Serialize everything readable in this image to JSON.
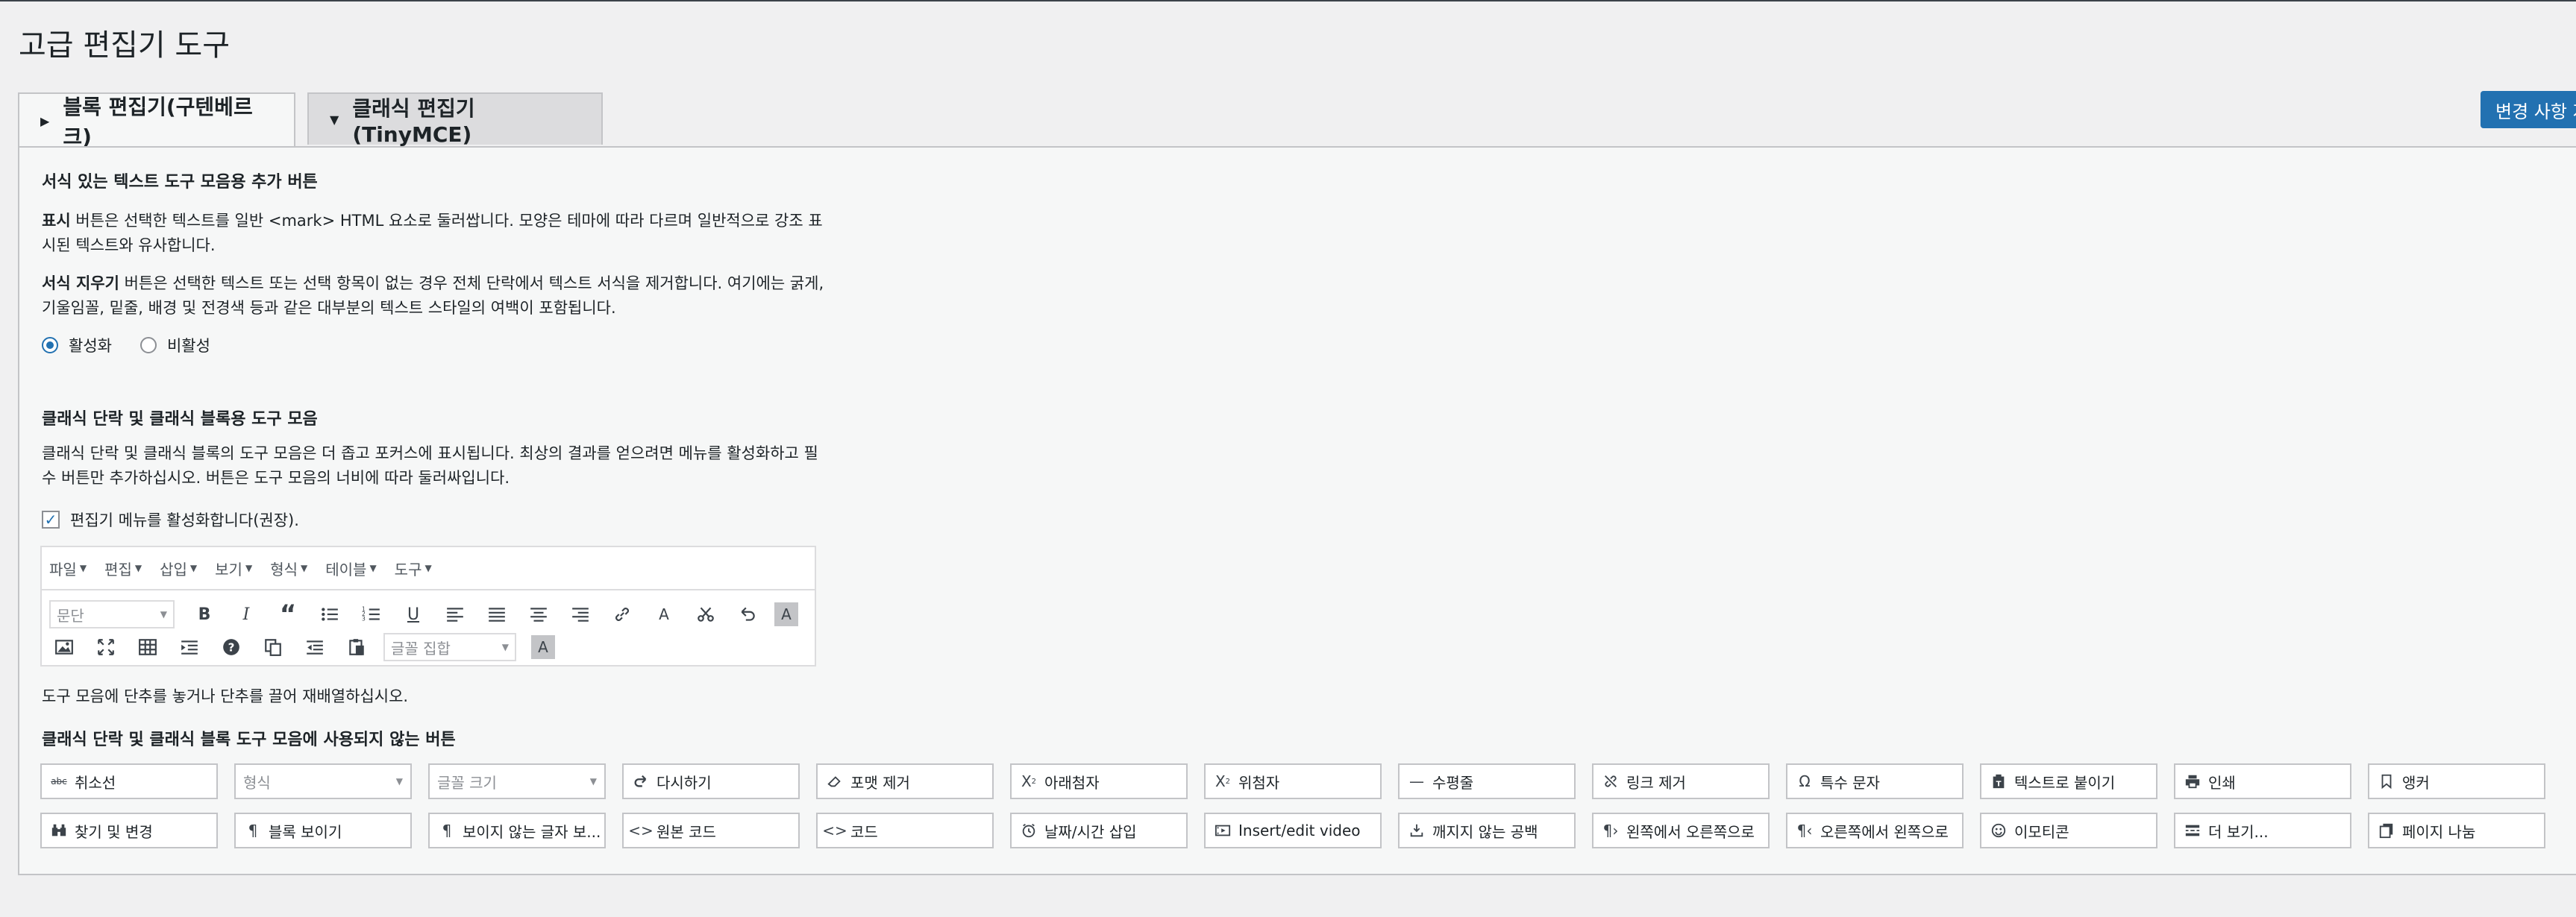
{
  "page_title": "고급 편집기 도구",
  "tabs": [
    {
      "label": "블록 편집기(구텐베르크)",
      "state": "expanded"
    },
    {
      "label": "클래식 편집기(TinyMCE)",
      "state": "collapsed"
    }
  ],
  "save_button": "변경 사항 저장",
  "section1": {
    "heading": "서식 있는 텍스트 도구 모음용 추가 버튼",
    "p1_strong": "표시",
    "p1_rest": " 버튼은 선택한 텍스트를 일반 <mark> HTML 요소로 둘러쌉니다. 모양은 테마에 따라 다르며 일반적으로 강조 표시된 텍스트와 유사합니다.",
    "p2_strong": "서식 지우기",
    "p2_rest": " 버튼은 선택한 텍스트 또는 선택 항목이 없는 경우 전체 단락에서 텍스트 서식을 제거합니다. 여기에는 굵게, 기울임꼴, 밑줄, 배경 및 전경색 등과 같은 대부분의 텍스트 스타일의 여백이 포함됩니다.",
    "radio_on": "활성화",
    "radio_off": "비활성",
    "selected": "활성화"
  },
  "section2": {
    "heading": "클래식 단락 및 클래식 블록용 도구 모음",
    "p1": "클래식 단락 및 클래식 블록의 도구 모음은 더 좁고 포커스에 표시됩니다. 최상의 결과를 얻으려면 메뉴를 활성화하고 필수 버튼만 추가하십시오. 버튼은 도구 모음의 너비에 따라 둘러싸입니다.",
    "checkbox_label": "편집기 메뉴를 활성화합니다(권장).",
    "checkbox_checked": true,
    "menu": [
      "파일",
      "편집",
      "삽입",
      "보기",
      "형식",
      "테이블",
      "도구"
    ],
    "toolbar_row1": [
      "paragraph-select",
      "bold-icon",
      "italic-icon",
      "blockquote-icon",
      "bullet-list-icon",
      "numbered-list-icon",
      "underline-icon",
      "align-left-icon",
      "align-justify-icon",
      "align-center-icon",
      "align-right-icon",
      "link-icon",
      "text-color-icon",
      "cut-icon",
      "undo-icon",
      "highlight-icon"
    ],
    "paragraph_select": "문단",
    "font_family_select": "글꼴 집합",
    "text_color_glyph": "A",
    "hint": "도구 모음에 단추를 놓거나 단추를 끌어 재배열하십시오.",
    "unused_heading": "클래식 단락 및 클래식 블록 도구 모음에 사용되지 않는 버튼",
    "unused_row1": [
      {
        "label": "취소선",
        "icon": "strikethrough-icon"
      },
      {
        "label": "형식",
        "icon": "select"
      },
      {
        "label": "글꼴 크기",
        "icon": "select"
      },
      {
        "label": "다시하기",
        "icon": "redo-icon"
      },
      {
        "label": "포맷 제거",
        "icon": "eraser-icon"
      },
      {
        "label": "아래첨자",
        "icon": "subscript-icon"
      },
      {
        "label": "위첨자",
        "icon": "superscript-icon"
      },
      {
        "label": "수평줄",
        "icon": "horizontal-rule-icon"
      },
      {
        "label": "링크 제거",
        "icon": "unlink-icon"
      },
      {
        "label": "특수 문자",
        "icon": "omega-icon"
      },
      {
        "label": "텍스트로 붙이기",
        "icon": "paste-text-icon"
      },
      {
        "label": "인쇄",
        "icon": "print-icon"
      },
      {
        "label": "앵커",
        "icon": "bookmark-icon"
      }
    ],
    "unused_row2": [
      {
        "label": "찾기 및 변경",
        "icon": "binoculars-icon"
      },
      {
        "label": "블록 보이기",
        "icon": "pilcrow-icon"
      },
      {
        "label": "보이지 않는 글자 보...",
        "icon": "pilcrow-icon"
      },
      {
        "label": "원본 코드",
        "icon": "code-icon"
      },
      {
        "label": "코드",
        "icon": "code-icon"
      },
      {
        "label": "날짜/시간 삽입",
        "icon": "clock-icon"
      },
      {
        "label": "Insert/edit video",
        "icon": "video-icon"
      },
      {
        "label": "깨지지 않는 공백",
        "icon": "nbsp-icon"
      },
      {
        "label": "왼쪽에서 오른쪽으로",
        "icon": "ltr-icon"
      },
      {
        "label": "오른쪽에서 왼쪽으로",
        "icon": "rtl-icon"
      },
      {
        "label": "이모티콘",
        "icon": "emoticon-icon"
      },
      {
        "label": "더 보기...",
        "icon": "read-more-icon"
      },
      {
        "label": "페이지 나눔",
        "icon": "page-break-icon"
      }
    ]
  },
  "colors": {
    "accent": "#2271b1",
    "panel": "#f6f7f7",
    "background": "#f0f0f1",
    "border": "#c3c4c7"
  }
}
